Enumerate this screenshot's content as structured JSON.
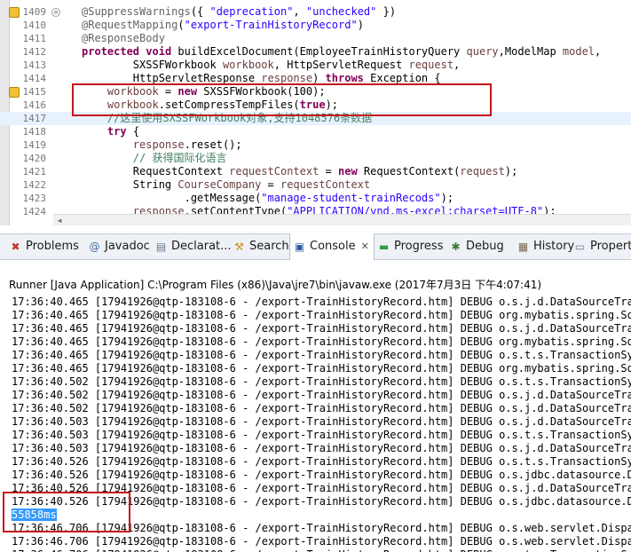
{
  "editor": {
    "lines": [
      {
        "no": "1409",
        "fold": "⊖",
        "warn": true,
        "segments": [
          [
            "an",
            "@SuppressWarnings"
          ],
          [
            "",
            "({ "
          ],
          [
            "st",
            "\"deprecation\""
          ],
          [
            "",
            ", "
          ],
          [
            "st",
            "\"unchecked\""
          ],
          [
            "",
            " })"
          ]
        ]
      },
      {
        "no": "1410",
        "segments": [
          [
            "an",
            "@RequestMapping"
          ],
          [
            "",
            "("
          ],
          [
            "st",
            "\"export-TrainHistoryRecord\""
          ],
          [
            "",
            ")"
          ]
        ]
      },
      {
        "no": "1411",
        "segments": [
          [
            "an",
            "@ResponseBody"
          ]
        ]
      },
      {
        "no": "1412",
        "segments": [
          [
            "kw",
            "protected"
          ],
          [
            "",
            " "
          ],
          [
            "kw",
            "void"
          ],
          [
            "",
            " buildExcelDocument(EmployeeTrainHistoryQuery "
          ],
          [
            "pm",
            "query"
          ],
          [
            "",
            ",ModelMap "
          ],
          [
            "pm",
            "model"
          ],
          [
            "",
            ","
          ]
        ]
      },
      {
        "no": "1413",
        "segments": [
          [
            "",
            "        SXSSFWorkbook "
          ],
          [
            "pm",
            "workbook"
          ],
          [
            "",
            ", HttpServletRequest "
          ],
          [
            "pm",
            "request"
          ],
          [
            "",
            ","
          ]
        ]
      },
      {
        "no": "1414",
        "segments": [
          [
            "",
            "        HttpServletResponse "
          ],
          [
            "pm",
            "response"
          ],
          [
            "",
            ") "
          ],
          [
            "kw",
            "throws"
          ],
          [
            "",
            " Exception {"
          ]
        ]
      },
      {
        "no": "1415",
        "warn": true,
        "segments": [
          [
            "",
            "    "
          ],
          [
            "pm",
            "workbook"
          ],
          [
            "",
            " = "
          ],
          [
            "kw",
            "new"
          ],
          [
            "",
            " SXSSFWorkbook(100);"
          ]
        ]
      },
      {
        "no": "1416",
        "segments": [
          [
            "",
            "    "
          ],
          [
            "pm",
            "workbook"
          ],
          [
            "",
            ".setCompressTempFiles("
          ],
          [
            "kw",
            "true"
          ],
          [
            "",
            ");"
          ]
        ]
      },
      {
        "no": "1417",
        "current": true,
        "segments": [
          [
            "cm",
            "    //这里使用SXSSFWorkbook对象,支持1048576条数据"
          ]
        ]
      },
      {
        "no": "1418",
        "segments": [
          [
            "",
            "    "
          ],
          [
            "kw",
            "try"
          ],
          [
            "",
            " {"
          ]
        ]
      },
      {
        "no": "1419",
        "segments": [
          [
            "",
            "        "
          ],
          [
            "pm",
            "response"
          ],
          [
            "",
            ".reset();"
          ]
        ]
      },
      {
        "no": "1420",
        "segments": [
          [
            "cm",
            "        // 获得国际化语言"
          ]
        ]
      },
      {
        "no": "1421",
        "segments": [
          [
            "",
            "        RequestContext "
          ],
          [
            "pm",
            "requestContext"
          ],
          [
            "",
            " = "
          ],
          [
            "kw",
            "new"
          ],
          [
            "",
            " RequestContext("
          ],
          [
            "pm",
            "request"
          ],
          [
            "",
            ");"
          ]
        ]
      },
      {
        "no": "1422",
        "segments": [
          [
            "",
            "        String "
          ],
          [
            "pm",
            "CourseCompany"
          ],
          [
            "",
            " = "
          ],
          [
            "pm",
            "requestContext"
          ]
        ]
      },
      {
        "no": "1423",
        "segments": [
          [
            "",
            "                .getMessage("
          ],
          [
            "st",
            "\"manage-student-trainRecods\""
          ],
          [
            "",
            ");"
          ]
        ]
      },
      {
        "no": "1424",
        "segments": [
          [
            "",
            "        "
          ],
          [
            "pm",
            "response"
          ],
          [
            "",
            ".setContentType("
          ],
          [
            "st",
            "\"APPLICATION/vnd.ms-excel;charset=UTF-8\""
          ],
          [
            "",
            ");"
          ]
        ]
      }
    ]
  },
  "tabs": [
    {
      "id": "problems",
      "icon": "problems-icon",
      "glyph": "✖",
      "color": "#c0392b",
      "label": "Problems"
    },
    {
      "id": "javadoc",
      "icon": "javadoc-icon",
      "glyph": "@",
      "color": "#4a6fa5",
      "label": "Javadoc"
    },
    {
      "id": "declaration",
      "icon": "declaration-icon",
      "glyph": "▤",
      "color": "#6b7c93",
      "label": "Declarat..."
    },
    {
      "id": "search",
      "icon": "search-icon",
      "glyph": "⚒",
      "color": "#c9941e",
      "label": "Search"
    },
    {
      "id": "console",
      "icon": "console-icon",
      "glyph": "▣",
      "color": "#2e5aa6",
      "label": "Console",
      "active": true,
      "close": "✕"
    },
    {
      "id": "progress",
      "icon": "progress-icon",
      "glyph": "▬",
      "color": "#2f9e44",
      "label": "Progress"
    },
    {
      "id": "debug",
      "icon": "debug-icon",
      "glyph": "✱",
      "color": "#3d7b3d",
      "label": "Debug"
    },
    {
      "id": "history",
      "icon": "history-icon",
      "glyph": "▦",
      "color": "#7a6a4a",
      "label": "History"
    },
    {
      "id": "properties",
      "icon": "properties-icon",
      "glyph": "▭",
      "color": "#6b7c93",
      "label": "Propert"
    }
  ],
  "console": {
    "header": "Runner [Java Application] C:\\Program Files (x86)\\Java\\jre7\\bin\\javaw.exe (2017年7月3日 下午4:07:41)",
    "lines": [
      "17:36:40.465 [17941926@qtp-183108-6 - /export-TrainHistoryRecord.htm] DEBUG o.s.j.d.DataSourceTransa",
      "17:36:40.465 [17941926@qtp-183108-6 - /export-TrainHistoryRecord.htm] DEBUG org.mybatis.spring.SqlSe",
      "17:36:40.465 [17941926@qtp-183108-6 - /export-TrainHistoryRecord.htm] DEBUG o.s.j.d.DataSourceTransa",
      "17:36:40.465 [17941926@qtp-183108-6 - /export-TrainHistoryRecord.htm] DEBUG org.mybatis.spring.SqlSe",
      "17:36:40.465 [17941926@qtp-183108-6 - /export-TrainHistoryRecord.htm] DEBUG o.s.t.s.TransactionSynch",
      "17:36:40.465 [17941926@qtp-183108-6 - /export-TrainHistoryRecord.htm] DEBUG org.mybatis.spring.SqlSe",
      "17:36:40.502 [17941926@qtp-183108-6 - /export-TrainHistoryRecord.htm] DEBUG o.s.t.s.TransactionSynch",
      "17:36:40.502 [17941926@qtp-183108-6 - /export-TrainHistoryRecord.htm] DEBUG o.s.j.d.DataSourceTransa",
      "17:36:40.502 [17941926@qtp-183108-6 - /export-TrainHistoryRecord.htm] DEBUG o.s.j.d.DataSourceTransa",
      "17:36:40.503 [17941926@qtp-183108-6 - /export-TrainHistoryRecord.htm] DEBUG o.s.j.d.DataSourceTransa",
      "17:36:40.503 [17941926@qtp-183108-6 - /export-TrainHistoryRecord.htm] DEBUG o.s.t.s.TransactionSynch",
      "17:36:40.503 [17941926@qtp-183108-6 - /export-TrainHistoryRecord.htm] DEBUG o.s.j.d.DataSourceTransa",
      "17:36:40.526 [17941926@qtp-183108-6 - /export-TrainHistoryRecord.htm] DEBUG o.s.t.s.TransactionSynch",
      "17:36:40.526 [17941926@qtp-183108-6 - /export-TrainHistoryRecord.htm] DEBUG o.s.jdbc.datasource.Data",
      "17:36:40.526 [17941926@qtp-183108-6 - /export-TrainHistoryRecord.htm] DEBUG o.s.j.d.DataSourceTransa",
      "17:36:40.526 [17941926@qtp-183108-6 - /export-TrainHistoryRecord.htm] DEBUG o.s.jdbc.datasource.Data",
      {
        "text": "55858ms",
        "selected": true
      },
      "17:36:46.706 [17941926@qtp-183108-6 - /export-TrainHistoryRecord.htm] DEBUG o.s.web.servlet.Dispatch",
      "17:36:46.706 [17941926@qtp-183108-6 - /export-TrainHistoryRecord.htm] DEBUG o.s.web.servlet.Dispatch",
      "17:36:46.706 [17941926@qtp-183108-6 - /export-TrainHistoryRecord.htm] DEBUG o.s.t.s.TransactionSynch"
    ]
  },
  "colors": {
    "highlight_box": "#c4161c",
    "selection": "#3399ff"
  }
}
